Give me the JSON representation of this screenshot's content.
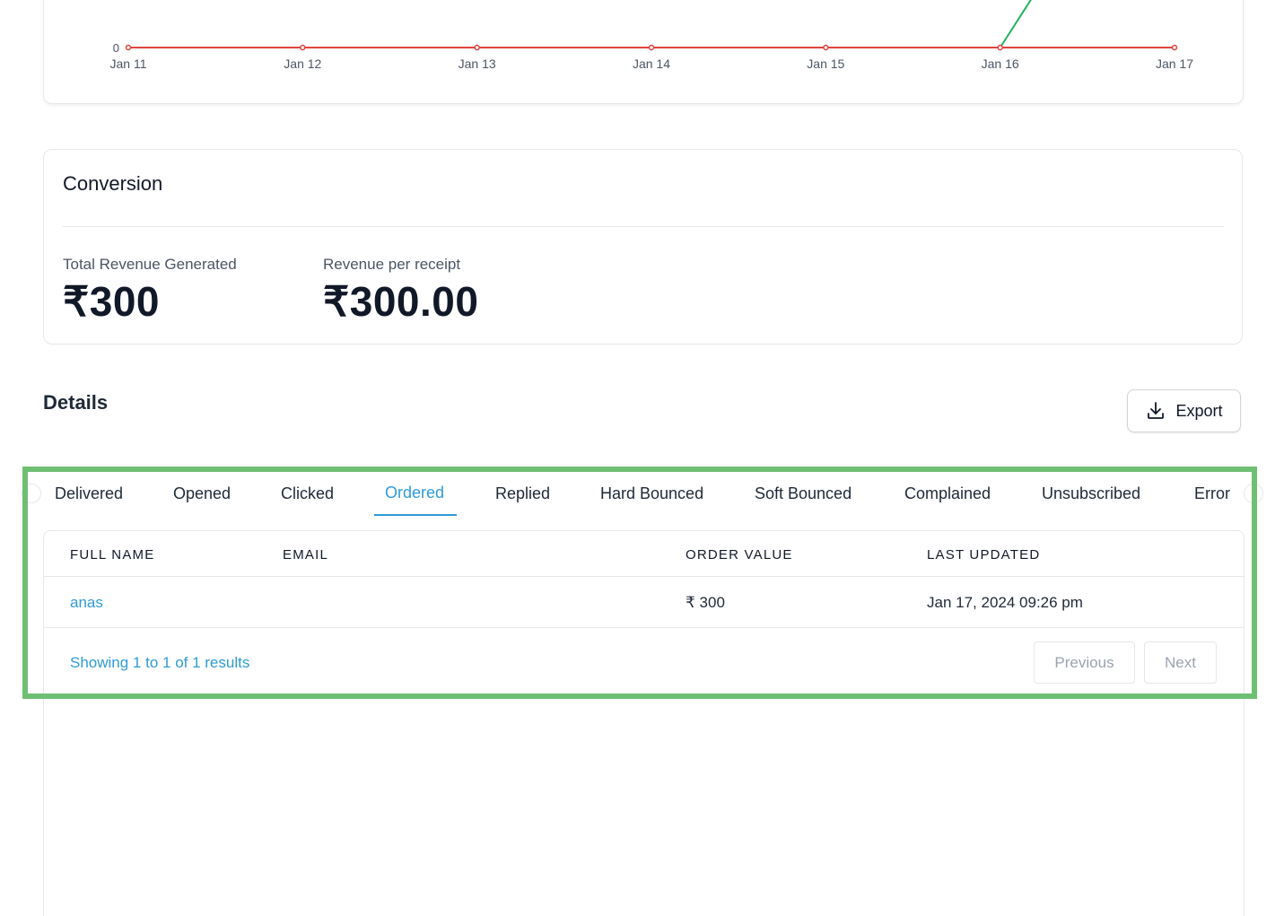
{
  "chart_data": {
    "type": "line",
    "categories": [
      "Jan 11",
      "Jan 12",
      "Jan 13",
      "Jan 14",
      "Jan 15",
      "Jan 16",
      "Jan 17"
    ],
    "visible_y_ticks": [
      "0"
    ],
    "series": [
      {
        "color": "#e0443e",
        "values": [
          0,
          0,
          0,
          0,
          0,
          0,
          0
        ]
      },
      {
        "color": "#22b35e",
        "values": [
          null,
          null,
          null,
          null,
          null,
          0,
          null
        ],
        "note_direction": "rising after Jan 16 (cropped)"
      }
    ]
  },
  "conversion": {
    "title": "Conversion",
    "total_revenue_label": "Total Revenue Generated",
    "total_revenue_value": "₹300",
    "revenue_per_receipt_label": "Revenue per receipt",
    "revenue_per_receipt_value": "₹300.00"
  },
  "details": {
    "title": "Details",
    "export_label": "Export"
  },
  "tabs": [
    {
      "label": "Delivered",
      "active": false
    },
    {
      "label": "Opened",
      "active": false
    },
    {
      "label": "Clicked",
      "active": false
    },
    {
      "label": "Ordered",
      "active": true
    },
    {
      "label": "Replied",
      "active": false
    },
    {
      "label": "Hard Bounced",
      "active": false
    },
    {
      "label": "Soft Bounced",
      "active": false
    },
    {
      "label": "Complained",
      "active": false
    },
    {
      "label": "Unsubscribed",
      "active": false
    },
    {
      "label": "Error",
      "active": false
    }
  ],
  "table": {
    "columns": [
      "FULL NAME",
      "EMAIL",
      "ORDER VALUE",
      "LAST UPDATED"
    ],
    "rows": [
      {
        "full_name": "anas",
        "email": "",
        "order_value": "₹ 300",
        "last_updated": "Jan 17, 2024 09:26 pm"
      }
    ],
    "showing_text": "Showing 1 to 1 of 1 results",
    "previous_label": "Previous",
    "next_label": "Next"
  },
  "colors": {
    "accent": "#2f9bd6",
    "highlight_border": "#6fbf73",
    "line_red": "#e0443e",
    "line_green": "#22b35e"
  }
}
